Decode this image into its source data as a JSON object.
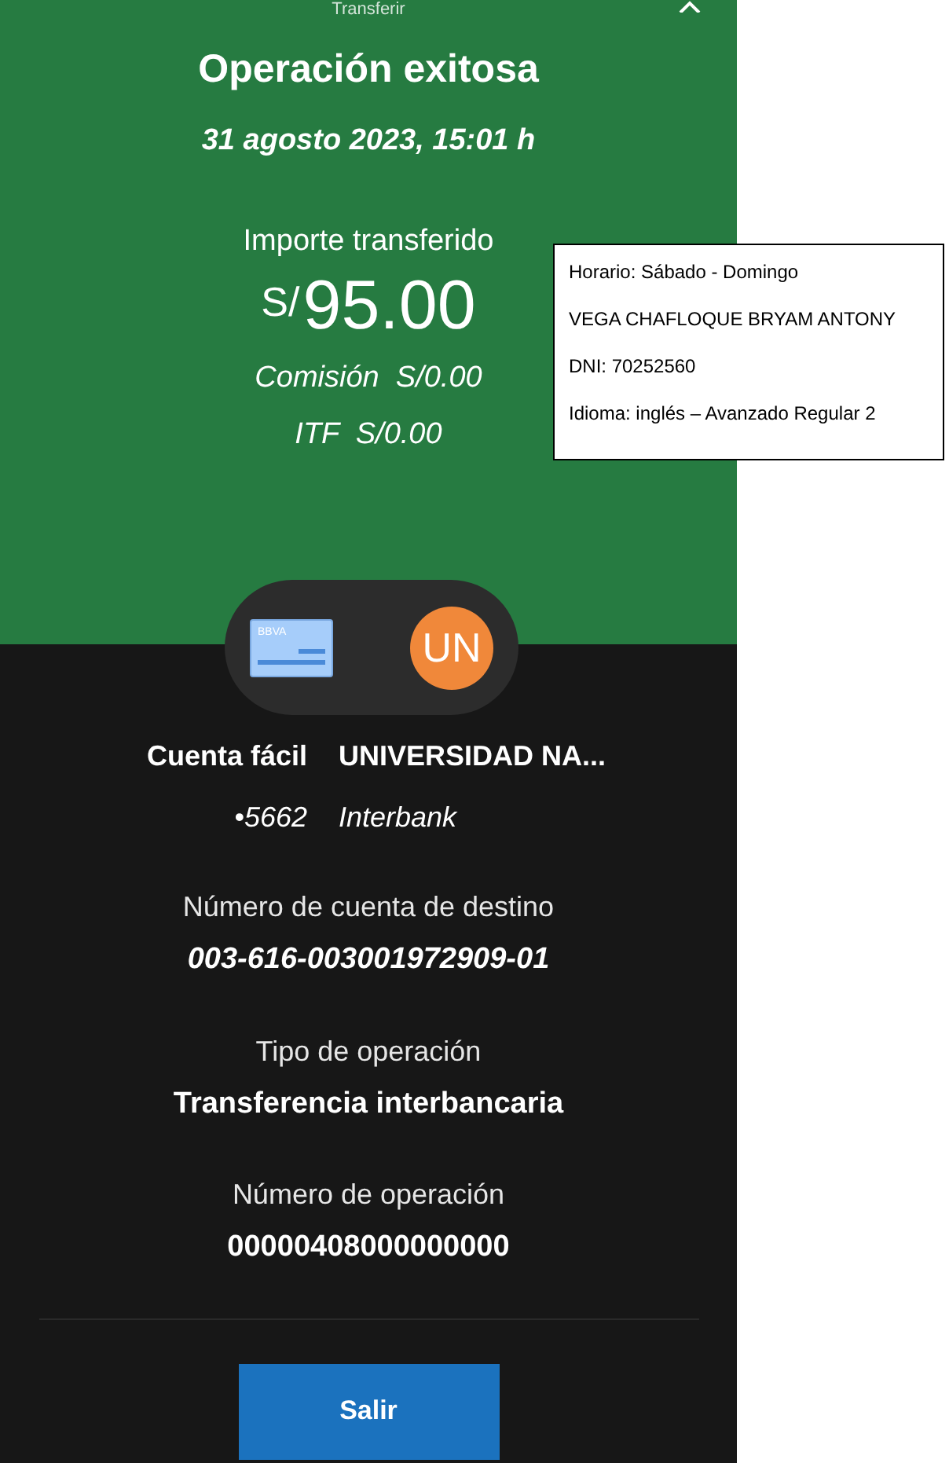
{
  "header": {
    "title": "Transferir"
  },
  "status": {
    "title": "Operación exitosa",
    "datetime": "31 agosto 2023, 15:01 h"
  },
  "amount": {
    "label": "Importe transferido",
    "currency": "S/",
    "value": "95.00",
    "commission": "Comisión  S/0.00",
    "itf": "ITF  S/0.00"
  },
  "origin": {
    "bank_logo": "BBVA",
    "name": "Cuenta fácil",
    "number": "•5662"
  },
  "destination": {
    "initials": "UN",
    "name": "UNIVERSIDAD NA...",
    "bank": "Interbank"
  },
  "details": [
    {
      "label": "Número de cuenta de destino",
      "value": "003-616-003001972909-01",
      "italic": true
    },
    {
      "label": "Tipo de operación",
      "value": "Transferencia interbancaria",
      "italic": false
    },
    {
      "label": "Número de operación",
      "value": "00000408000000000",
      "italic": false
    }
  ],
  "button": "Salir",
  "note": [
    "Horario: Sábado - Domingo",
    "VEGA CHAFLOQUE BRYAM ANTONY",
    "DNI: 70252560",
    "Idioma: inglés – Avanzado Regular 2"
  ]
}
